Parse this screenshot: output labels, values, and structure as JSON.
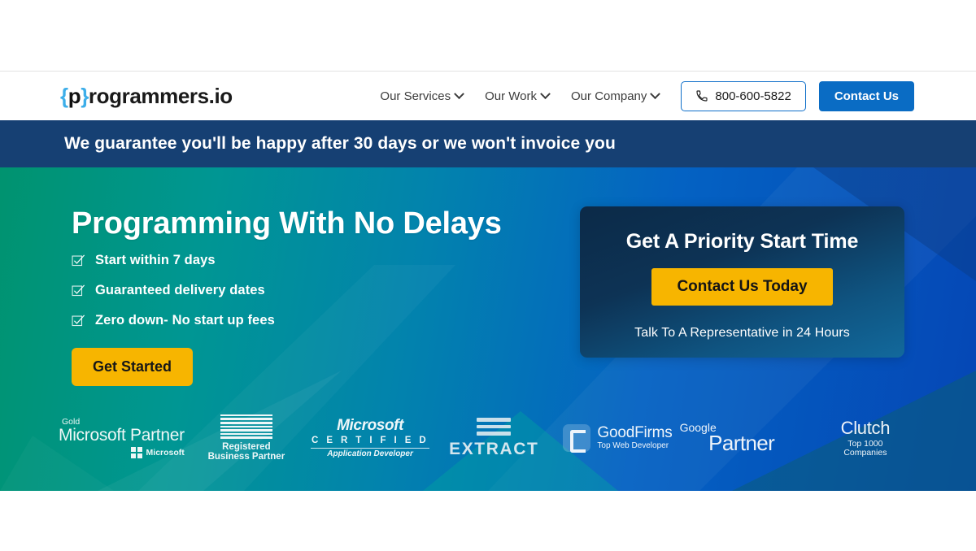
{
  "site": {
    "logo": {
      "brace_open": "{",
      "p": "p",
      "brace_close": "}",
      "rest": "rogrammers.io"
    }
  },
  "header": {
    "nav": [
      {
        "label": "Our Services",
        "has_dropdown": true
      },
      {
        "label": "Our Work",
        "has_dropdown": true
      },
      {
        "label": "Our Company",
        "has_dropdown": true
      }
    ],
    "phone": "800-600-5822",
    "contact_label": "Contact Us",
    "colors": {
      "accent_blue": "#0a6cc4",
      "border_blue": "#0f6fc9"
    }
  },
  "banner": {
    "text": "We guarantee you'll be happy after 30 days or we won't invoice you",
    "bg": "#164073"
  },
  "hero": {
    "headline": "Programming With No Delays",
    "bullets": [
      "Start within 7 days",
      "Guaranteed delivery dates",
      "Zero down- No start up fees"
    ],
    "cta_label": "Get Started",
    "cta_color": "#f7b500",
    "gradient_from": "#00936f",
    "gradient_to": "#0546b5"
  },
  "priority_card": {
    "title": "Get A Priority Start Time",
    "button_label": "Contact Us Today",
    "subtext": "Talk To A Representative in 24 Hours",
    "button_color": "#f7b500"
  },
  "partners": {
    "microsoft_partner": {
      "tier": "Gold",
      "name": "Microsoft Partner",
      "brand": "Microsoft"
    },
    "ibm": {
      "name": "IBM",
      "line1": "Registered",
      "line2": "Business Partner"
    },
    "microsoft_certified": {
      "name": "Microsoft",
      "certified": "C E R T I F I E D",
      "role": "Application Developer"
    },
    "extract": {
      "name": "EXTRACT"
    },
    "goodfirms": {
      "name": "GoodFirms",
      "tagline": "Top Web Developer"
    },
    "google": {
      "line1": "Google",
      "line2": "Partner"
    },
    "clutch": {
      "name": "Clutch",
      "line1": "Top 1000",
      "line2": "Companies"
    }
  }
}
